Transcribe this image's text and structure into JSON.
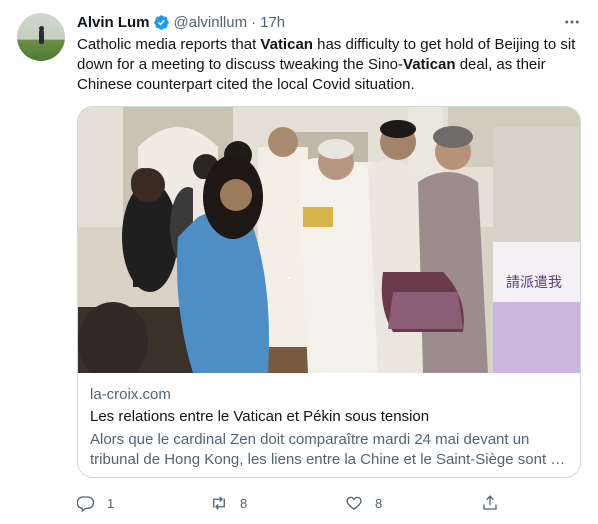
{
  "tweet": {
    "name": "Alvin Lum",
    "handle": "@alvinllum",
    "separator": "·",
    "time": "17h",
    "more_icon": "more-dots-icon",
    "text_parts": [
      "Catholic media reports that ",
      "Vatican",
      " has difficulty to get hold of Beijing to sit down for a meeting to discuss tweaking the Sino-",
      "Vatican",
      " deal, as their Chinese counterpart cited the local Covid situation."
    ],
    "verified_color": "#1d9bf0"
  },
  "card": {
    "domain": "la-croix.com",
    "title": "Les relations entre le Vatican et Pékin sous tension",
    "description": "Alors que le cardinal Zen doit comparaître mardi 24 mai devant un tribunal de Hong Kong, les liens entre la Chine et le Saint-Siège sont …",
    "banner_text": "請派遣我"
  },
  "actions": {
    "reply_count": "1",
    "retweet_count": "8",
    "like_count": "8"
  }
}
